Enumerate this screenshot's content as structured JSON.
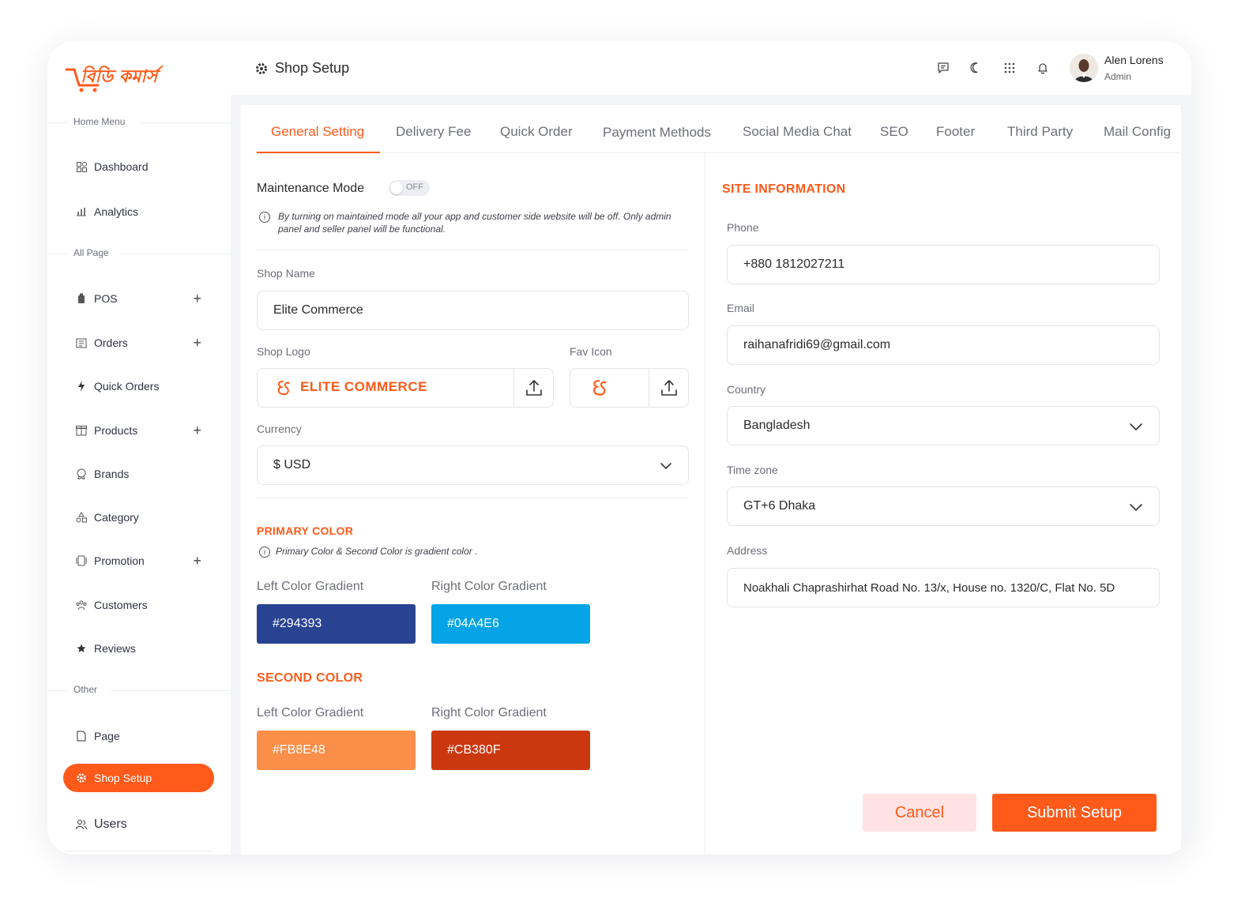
{
  "brand": {
    "logo_text": "বিডি কমার্স",
    "accent": "#ff5a1a"
  },
  "header": {
    "title": "Shop Setup"
  },
  "user": {
    "name": "Alen Lorens",
    "role": "Admin"
  },
  "sidebar": {
    "sections": [
      {
        "label": "Home Menu"
      },
      {
        "label": "All Page"
      },
      {
        "label": "Other"
      }
    ],
    "items": [
      {
        "label": "Dashboard",
        "icon": "dashboard-icon"
      },
      {
        "label": "Analytics",
        "icon": "analytics-icon"
      },
      {
        "label": "POS",
        "icon": "pos-icon",
        "expand": "+"
      },
      {
        "label": "Orders",
        "icon": "orders-icon",
        "expand": "+"
      },
      {
        "label": "Quick Orders",
        "icon": "bolt-icon"
      },
      {
        "label": "Products",
        "icon": "products-icon",
        "expand": "+"
      },
      {
        "label": "Brands",
        "icon": "brands-icon"
      },
      {
        "label": "Category",
        "icon": "category-icon"
      },
      {
        "label": "Promotion",
        "icon": "promotion-icon",
        "expand": "+"
      },
      {
        "label": "Customers",
        "icon": "customers-icon"
      },
      {
        "label": "Reviews",
        "icon": "star-icon"
      },
      {
        "label": "Page",
        "icon": "page-icon"
      },
      {
        "label": "Shop Setup",
        "icon": "gear-icon",
        "active": true
      },
      {
        "label": "Users",
        "icon": "users-icon"
      }
    ]
  },
  "tabs": [
    {
      "label": "General Setting",
      "active": true
    },
    {
      "label": "Delivery Fee"
    },
    {
      "label": "Quick Order"
    },
    {
      "label": "Payment Methods"
    },
    {
      "label": "Social Media Chat"
    },
    {
      "label": "SEO"
    },
    {
      "label": "Footer"
    },
    {
      "label": "Third Party"
    },
    {
      "label": "Mail Config"
    }
  ],
  "general": {
    "maintenance_label": "Maintenance Mode",
    "maintenance_state": "OFF",
    "maintenance_note": "By turning on maintained mode all your app and customer side website will be off. Only admin panel and seller panel will be functional.",
    "shop_name_label": "Shop  Name",
    "shop_name_value": "Elite Commerce",
    "shop_logo_label": "Shop Logo",
    "shop_logo_text": "ELITE COMMERCE",
    "fav_icon_label": "Fav Icon",
    "currency_label": "Currency",
    "currency_value": "$ USD",
    "primary_heading": "PRIMARY COLOR",
    "primary_note": "Primary Color & Second Color is gradient color .",
    "primary_left_label": "Left Color Gradient",
    "primary_right_label": "Right Color Gradient",
    "primary_left": "#294393",
    "primary_right": "#04A4E6",
    "second_heading": "SECOND COLOR",
    "second_left_label": "Left Color Gradient",
    "second_right_label": "Right Color Gradient",
    "second_left": "#FB8E48",
    "second_right": "#CB380F"
  },
  "site": {
    "heading": "SITE INFORMATION",
    "phone_label": "Phone",
    "phone_value": "+880 1812027211",
    "email_label": "Email",
    "email_value": "raihanafridi69@gmail.com",
    "country_label": "Country",
    "country_value": "Bangladesh",
    "timezone_label": "Time zone",
    "timezone_value": "GT+6 Dhaka",
    "address_label": "Address",
    "address_value": "Noakhali Chaprashirhat Road No. 13/x, House no. 1320/C, Flat No. 5D"
  },
  "actions": {
    "cancel": "Cancel",
    "submit": "Submit Setup"
  }
}
